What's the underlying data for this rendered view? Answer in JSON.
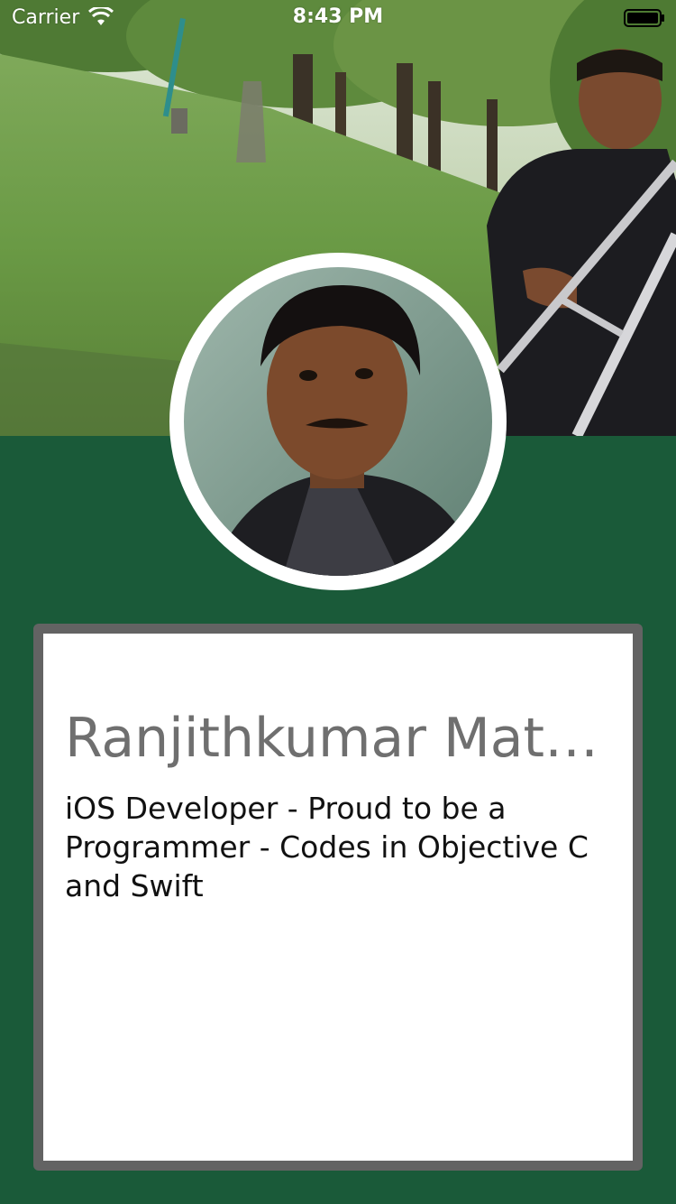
{
  "status_bar": {
    "carrier": "Carrier",
    "time": "8:43 PM"
  },
  "cover": {
    "description_icon": "park-photo"
  },
  "avatar": {
    "icon": "profile-photo"
  },
  "profile": {
    "name": "Ranjithkumar Math...",
    "bio": "iOS Developer - Proud to be a Programmer - Codes in Objective C and Swift"
  },
  "colors": {
    "background": "#1a5a39",
    "card_border": "#636363",
    "name_text": "#6f6f6f",
    "bio_text": "#111111"
  }
}
